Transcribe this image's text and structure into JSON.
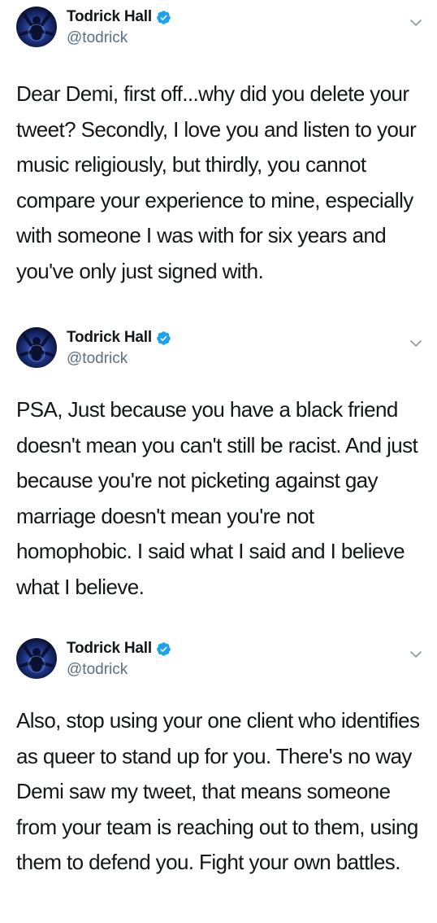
{
  "tweets": [
    {
      "name": "Todrick Hall",
      "handle": "@todrick",
      "text": "Dear Demi, first off...why did you delete your tweet? Secondly, I love you and listen to your music religiously, but thirdly, you cannot compare your experience to mine, especially with someone I was with for six years and you've only just signed with."
    },
    {
      "name": "Todrick Hall",
      "handle": "@todrick",
      "text": "PSA, Just because you have a black friend doesn't mean you can't still be racist. And just because you're not picketing against gay marriage doesn't mean you're not homophobic. I said what I said and I believe what I believe."
    },
    {
      "name": "Todrick Hall",
      "handle": "@todrick",
      "text": "Also, stop using your one client who identifies as queer to stand up for you. There's no way Demi saw my tweet, that means someone from your team is reaching out to them, using them to defend you. Fight your own battles."
    }
  ],
  "icons": {
    "verified": "verified-badge-icon",
    "caret": "chevron-down-icon",
    "avatar": "profile-avatar"
  },
  "colors": {
    "verified": "#1da1f2",
    "handle": "#5b7083",
    "text": "#14171a",
    "caret": "#8899a6"
  }
}
